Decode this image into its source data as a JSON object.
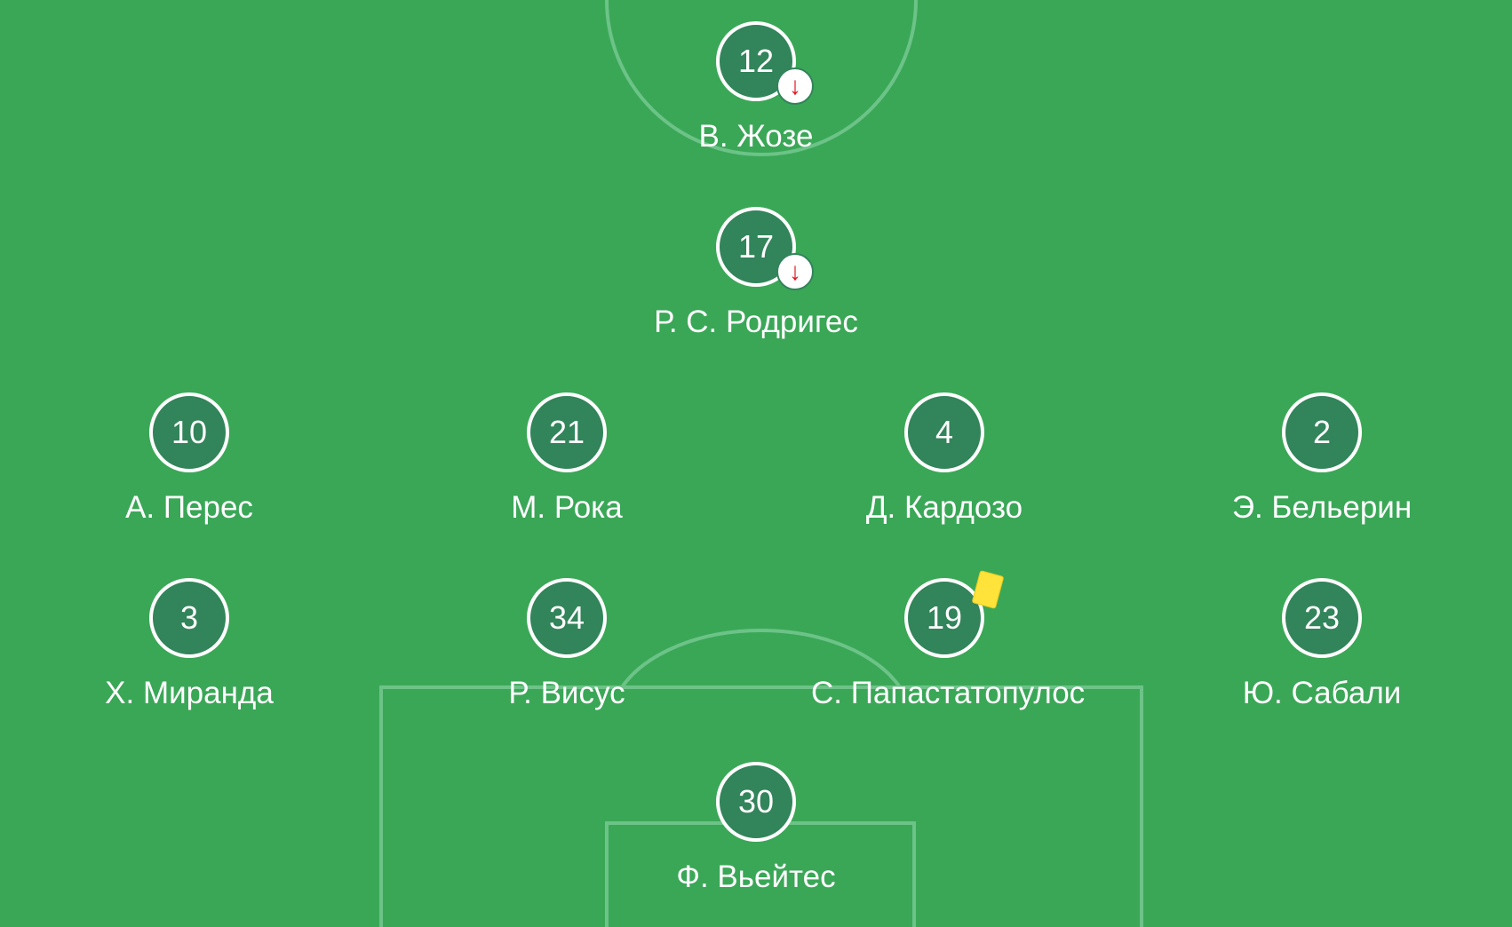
{
  "lineup": {
    "players": [
      {
        "number": "12",
        "name": "В. Жозе",
        "event": "substituted-off"
      },
      {
        "number": "17",
        "name": "Р. С. Родригес",
        "event": "substituted-off"
      },
      {
        "number": "10",
        "name": "А. Перес",
        "event": ""
      },
      {
        "number": "21",
        "name": "М. Рока",
        "event": ""
      },
      {
        "number": "4",
        "name": "Д. Кардозо",
        "event": ""
      },
      {
        "number": "2",
        "name": "Э. Бельерин",
        "event": ""
      },
      {
        "number": "3",
        "name": "Х. Миранда",
        "event": ""
      },
      {
        "number": "34",
        "name": "Р. Висус",
        "event": ""
      },
      {
        "number": "19",
        "name": "С. Папастатопулос",
        "event": "yellow-card"
      },
      {
        "number": "23",
        "name": "Ю. Сабали",
        "event": ""
      },
      {
        "number": "30",
        "name": "Ф. Вьейтес",
        "event": ""
      }
    ]
  },
  "icons": {
    "substitution": "arrow-down-icon",
    "booking": "yellow-card-icon"
  },
  "colors": {
    "pitch": "#3aa757",
    "badge": "#32845a",
    "sub_arrow": "#e0141e",
    "yellow_card": "#ffe23a"
  }
}
